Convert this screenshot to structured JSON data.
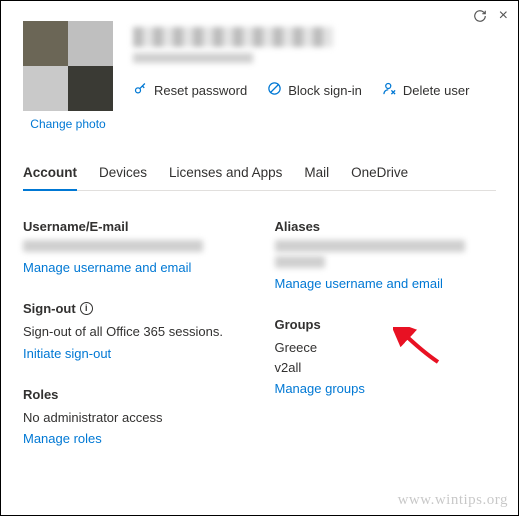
{
  "window": {
    "refresh_icon": "refresh-icon",
    "close_icon": "×"
  },
  "header": {
    "change_photo": "Change photo",
    "actions": {
      "reset": "Reset password",
      "block": "Block sign-in",
      "delete": "Delete user"
    }
  },
  "tabs": {
    "account": "Account",
    "devices": "Devices",
    "licenses": "Licenses and Apps",
    "mail": "Mail",
    "onedrive": "OneDrive"
  },
  "account": {
    "username_title": "Username/E-mail",
    "username_link": "Manage username and email",
    "signout_title": "Sign-out",
    "signout_body": "Sign-out of all Office 365 sessions.",
    "signout_link": "Initiate sign-out",
    "roles_title": "Roles",
    "roles_body": "No administrator access",
    "roles_link": "Manage roles",
    "aliases_title": "Aliases",
    "aliases_link": "Manage username and email",
    "groups_title": "Groups",
    "groups_list": [
      "Greece",
      "v2all"
    ],
    "groups_link": "Manage groups"
  },
  "watermark": "www.wintips.org"
}
